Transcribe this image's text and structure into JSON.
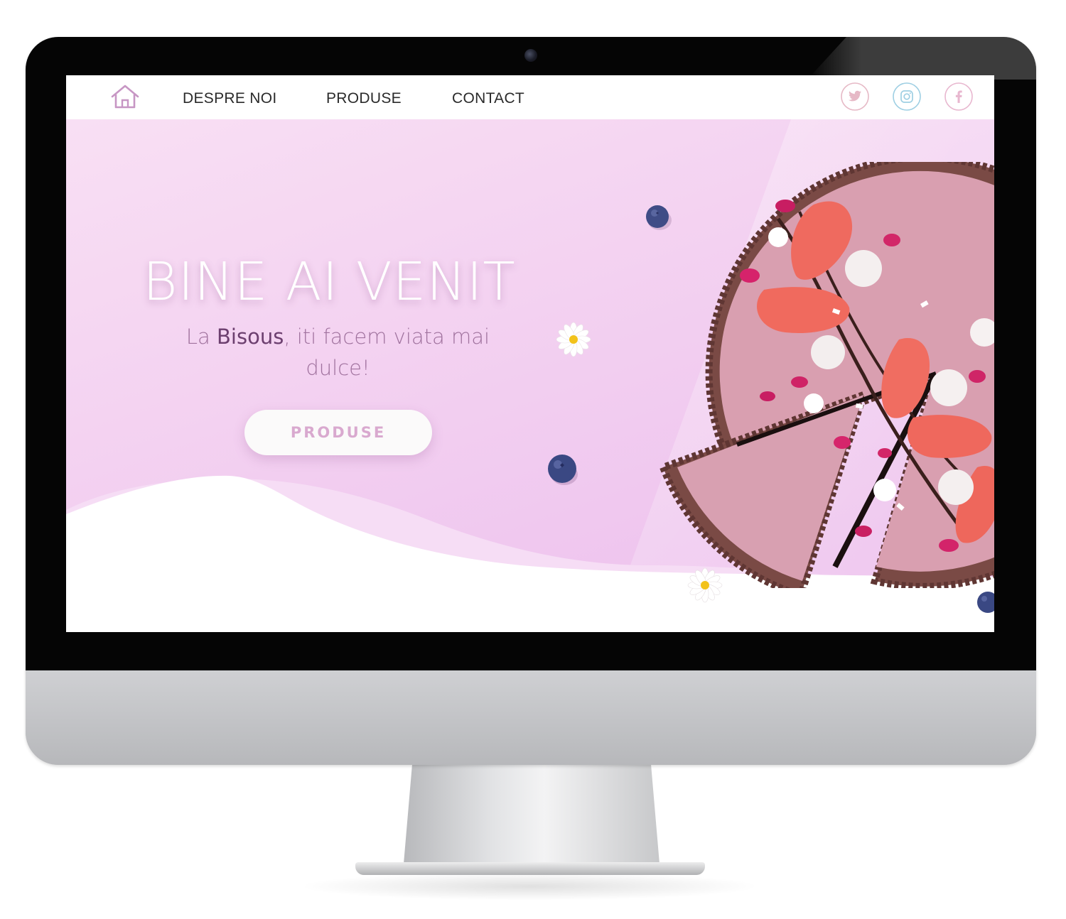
{
  "nav": {
    "home_icon": "home-icon",
    "links": [
      "DESPRE NOI",
      "PRODUSE",
      "CONTACT"
    ],
    "social_icons": [
      "twitter-icon",
      "instagram-icon",
      "facebook-icon"
    ]
  },
  "hero": {
    "title": "BINE AI VENIT",
    "subtitle_prefix": "La ",
    "subtitle_brand": "Bisous",
    "subtitle_suffix": ", iti facem viata mai dulce!",
    "button_label": "PRODUSE"
  },
  "colors": {
    "hero_gradient_light": "#f8ddf3",
    "hero_gradient_dark": "#efc6ef",
    "brand_purple": "#6c3f6f",
    "subtitle": "#a0729e",
    "button_text": "#d9a9cf",
    "twitter": "#e6b9c6",
    "instagram": "#9ecfe3",
    "facebook": "#e8b7cf"
  }
}
